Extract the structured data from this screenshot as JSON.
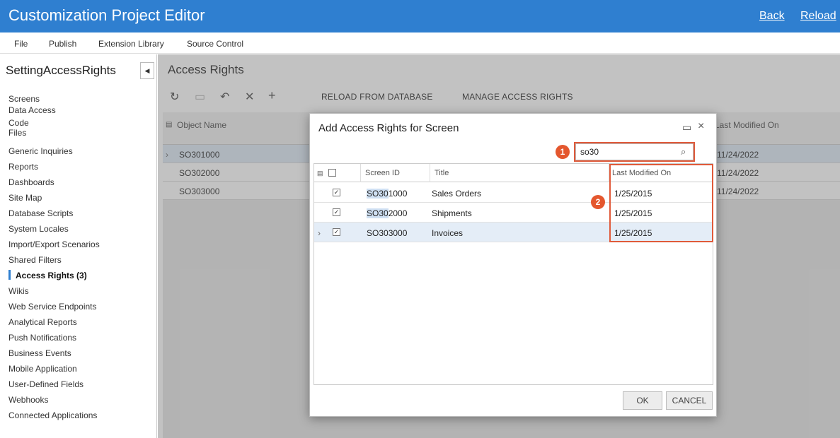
{
  "window": {
    "title": "Customization Project Editor",
    "back": "Back",
    "reload": "Reload"
  },
  "menu": [
    "File",
    "Publish",
    "Extension Library",
    "Source Control"
  ],
  "sidebar": {
    "project": "SettingAccessRights",
    "items": [
      "Screens",
      "Data Access",
      "Code",
      "Files",
      "Generic Inquiries",
      "Reports",
      "Dashboards",
      "Site Map",
      "Database Scripts",
      "System Locales",
      "Import/Export Scenarios",
      "Shared Filters",
      "Access Rights (3)",
      "Wikis",
      "Web Service Endpoints",
      "Analytical Reports",
      "Push Notifications",
      "Business Events",
      "Mobile Application",
      "User-Defined Fields",
      "Webhooks",
      "Connected Applications"
    ],
    "active_index": 12
  },
  "page": {
    "title": "Access Rights",
    "toolbar": {
      "reload_db": "RELOAD FROM DATABASE",
      "manage": "MANAGE ACCESS RIGHTS"
    },
    "grid": {
      "columns": {
        "object_name": "Object Name",
        "last_modified": "Last Modified On"
      },
      "rows": [
        {
          "object_name": "SO301000",
          "last_modified": "11/24/2022"
        },
        {
          "object_name": "SO302000",
          "last_modified": "11/24/2022"
        },
        {
          "object_name": "SO303000",
          "last_modified": "11/24/2022"
        }
      ]
    }
  },
  "dialog": {
    "title": "Add Access Rights for Screen",
    "search_value": "so30",
    "columns": {
      "screen_id": "Screen ID",
      "title": "Title",
      "last_modified": "Last Modified On"
    },
    "rows": [
      {
        "screen_id_match": "SO30",
        "screen_id_rest": "1000",
        "title": "Sales Orders",
        "last_modified": "1/25/2015",
        "checked": true
      },
      {
        "screen_id_match": "SO30",
        "screen_id_rest": "2000",
        "title": "Shipments",
        "last_modified": "1/25/2015",
        "checked": true
      },
      {
        "screen_id_match": "SO30",
        "screen_id_rest": "3000",
        "title": "Invoices",
        "last_modified": "1/25/2015",
        "checked": true
      }
    ],
    "ok": "OK",
    "cancel": "CANCEL"
  },
  "callouts": {
    "one": "1",
    "two": "2"
  },
  "colors": {
    "titlebar": "#2f7fd0",
    "callout": "#e4572e"
  }
}
